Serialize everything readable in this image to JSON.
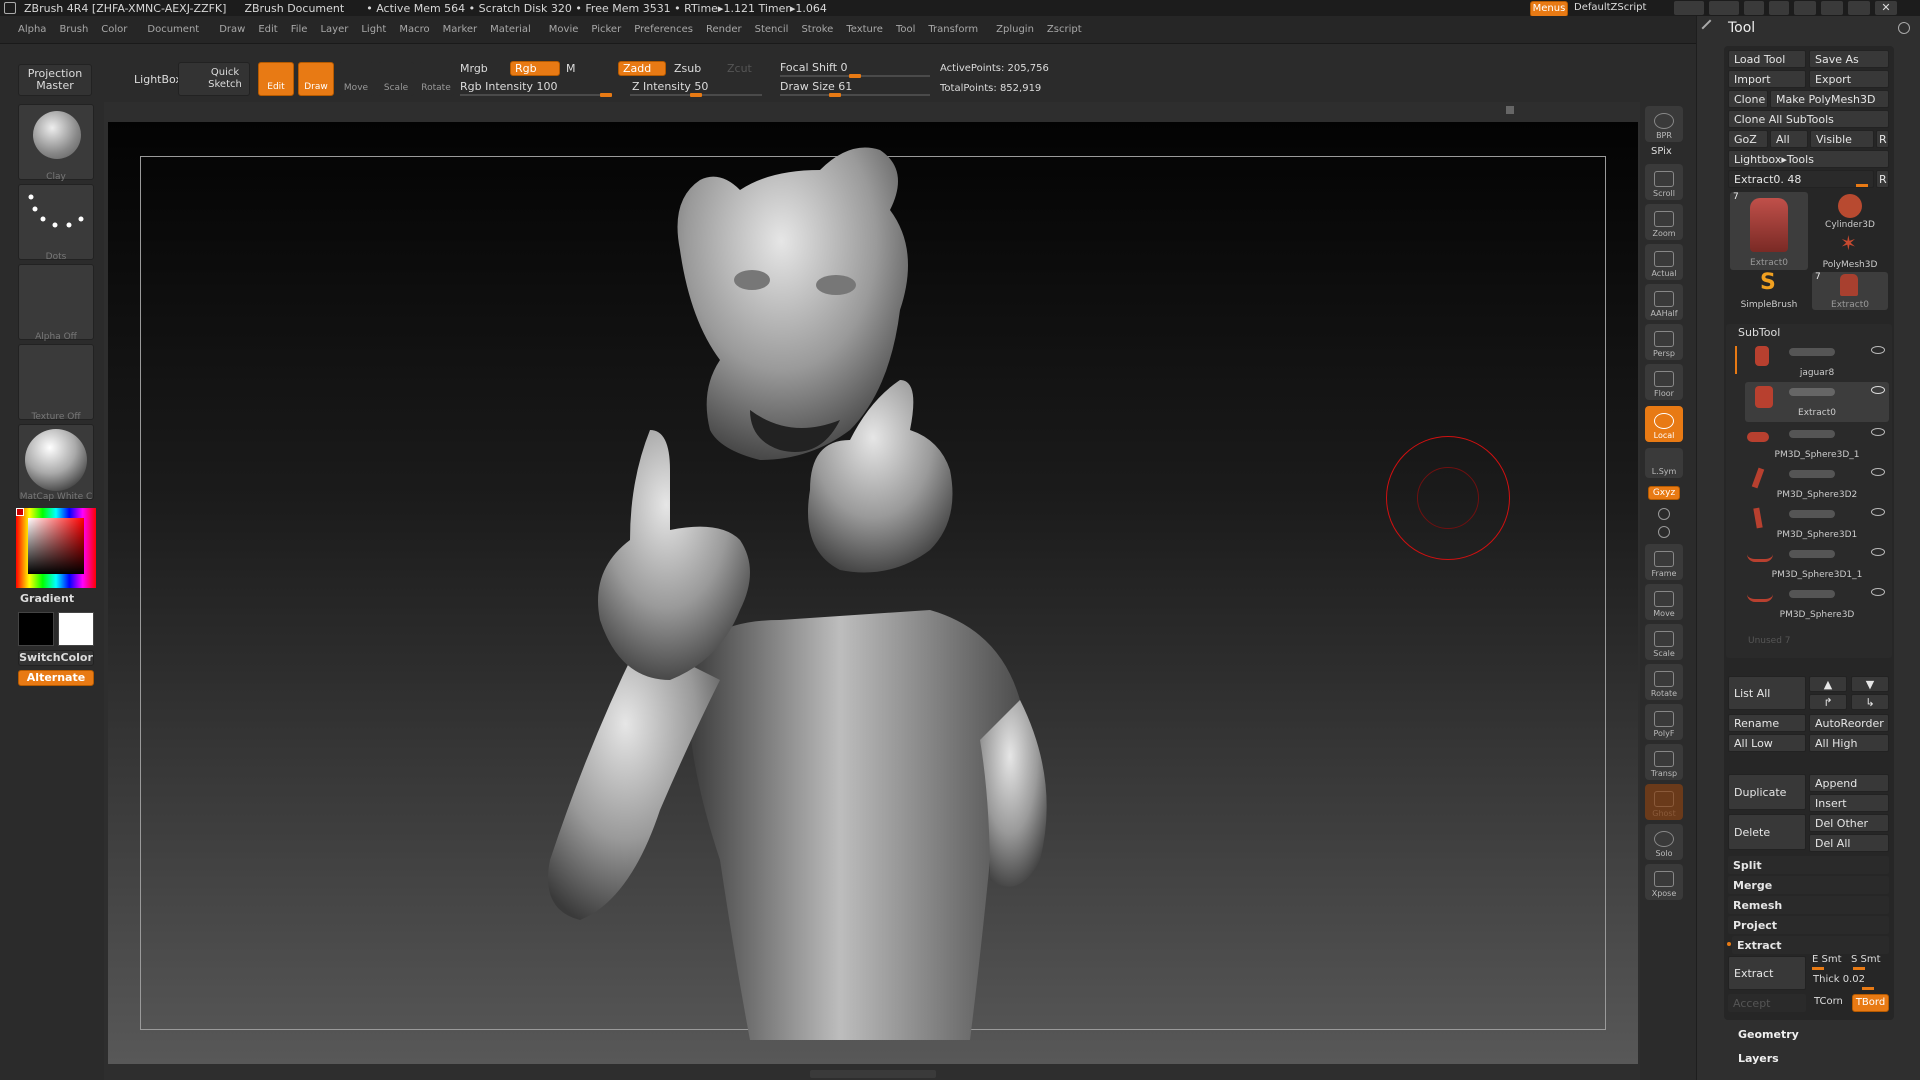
{
  "titlebar": {
    "app": "ZBrush 4R4 [ZHFA-XMNC-AEXJ-ZZFK]",
    "doc": "ZBrush Document",
    "stats": "• Active Mem 564 • Scratch Disk 320 • Free Mem 3531 • RTime▸1.121 Timer▸1.064",
    "menus_btn": "Menus",
    "script": "DefaultZScript"
  },
  "menubar": [
    "Alpha",
    "Brush",
    "Color",
    "Document",
    "Draw",
    "Edit",
    "File",
    "Layer",
    "Light",
    "Macro",
    "Marker",
    "Material",
    "Movie",
    "Picker",
    "Preferences",
    "Render",
    "Stencil",
    "Stroke",
    "Texture",
    "Tool",
    "Transform",
    "Zplugin",
    "Zscript"
  ],
  "toolbar": {
    "projection_master": "Projection Master",
    "lightbox": "LightBox",
    "quick_sketch": "Quick Sketch",
    "edit": "Edit",
    "draw": "Draw",
    "move": "Move",
    "scale": "Scale",
    "rotate": "Rotate",
    "mrgb": "Mrgb",
    "rgb": "Rgb",
    "m": "M",
    "zadd": "Zadd",
    "zsub": "Zsub",
    "zcut": "Zcut",
    "rgb_intensity": "Rgb Intensity 100",
    "rgb_intensity_value": 100,
    "z_intensity": "Z Intensity 50",
    "z_intensity_value": 50,
    "focal_shift": "Focal Shift 0",
    "focal_shift_value": 0,
    "draw_size": "Draw Size 61",
    "draw_size_value": 61,
    "active_points": "ActivePoints: 205,756",
    "total_points": "TotalPoints: 852,919"
  },
  "left_tray": {
    "brush": "Clay",
    "stroke": "Dots",
    "alpha": "Alpha Off",
    "texture": "Texture Off",
    "material": "MatCap White C",
    "gradient": "Gradient",
    "switch_color": "SwitchColor",
    "alternate": "Alternate"
  },
  "right_shelf": {
    "bpr": "BPR",
    "spix": "SPix",
    "scroll": "Scroll",
    "zoom": "Zoom",
    "actual": "Actual",
    "aahalf": "AAHalf",
    "persp": "Persp",
    "floor": "Floor",
    "local": "Local",
    "lsym": "L.Sym",
    "xyz": "Gxyz",
    "frame": "Frame",
    "move": "Move",
    "scale": "Scale",
    "rotate": "Rotate",
    "polyf": "PolyF",
    "transp": "Transp",
    "ghost": "Ghost",
    "solo": "Solo",
    "xpose": "Xpose"
  },
  "tool_panel": {
    "title": "Tool",
    "load_tool": "Load Tool",
    "save_as": "Save As",
    "import": "Import",
    "export": "Export",
    "clone": "Clone",
    "make_polymesh": "Make PolyMesh3D",
    "clone_all": "Clone All SubTools",
    "goz": "GoZ",
    "all": "All",
    "visible": "Visible",
    "r": "R",
    "lightbox_tools": "Lightbox▸Tools",
    "extract_slider": "Extract0. 48",
    "tools": [
      {
        "name": "Extract0",
        "count": "7"
      },
      {
        "name": "Cylinder3D",
        "count": ""
      },
      {
        "name": "PolyMesh3D",
        "count": ""
      },
      {
        "name": "SimpleBrush",
        "count": ""
      },
      {
        "name": "Extract0",
        "count": "7"
      }
    ],
    "subtool_header": "SubTool",
    "subtools": [
      "jaguar8",
      "Extract0",
      "PM3D_Sphere3D_1",
      "PM3D_Sphere3D2",
      "PM3D_Sphere3D1",
      "PM3D_Sphere3D1_1",
      "PM3D_Sphere3D"
    ],
    "unused": "Unused 7",
    "list_all": "List All",
    "rename": "Rename",
    "autoreorder": "AutoReorder",
    "all_low": "All Low",
    "all_high": "All High",
    "duplicate": "Duplicate",
    "append": "Append",
    "insert": "Insert",
    "delete": "Delete",
    "del_other": "Del Other",
    "del_all": "Del All",
    "split": "Split",
    "merge": "Merge",
    "remesh": "Remesh",
    "project": "Project",
    "extract": "Extract",
    "extract_btn": "Extract",
    "e_smt": "E Smt",
    "s_smt": "S Smt",
    "thick": "Thick 0.02",
    "accept": "Accept",
    "tcorn": "TCorn",
    "tbord": "TBord",
    "geometry": "Geometry",
    "layers": "Layers"
  },
  "colors": {
    "accent": "#e87a14",
    "panel": "#2f2f2f",
    "canvas_top": "#050505",
    "canvas_bottom": "#5a5a5a"
  }
}
